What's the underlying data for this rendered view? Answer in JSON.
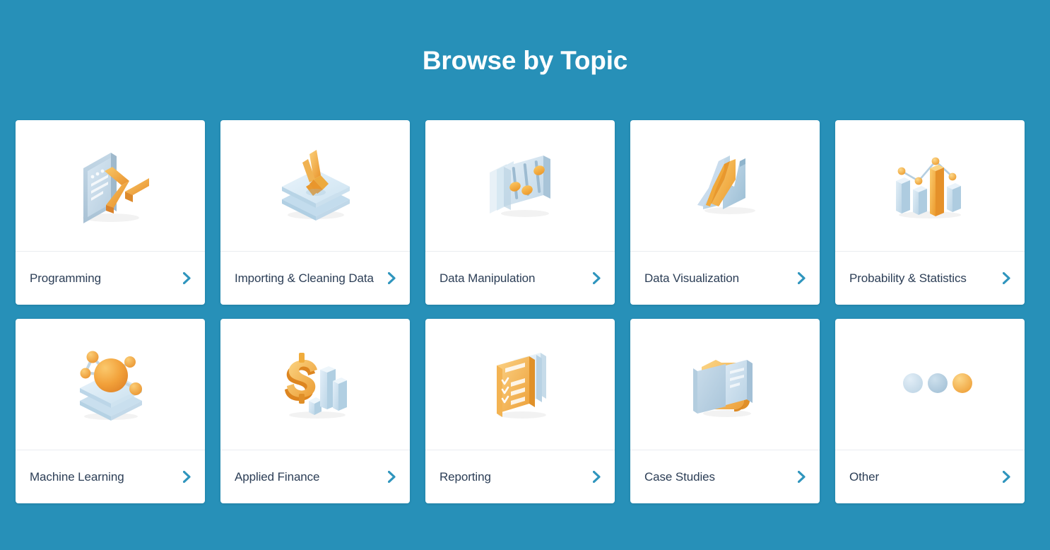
{
  "page": {
    "title": "Browse by Topic",
    "background_color": "#2790b8",
    "card_background_color": "#ffffff",
    "label_color": "#2c3e56",
    "chevron_color": "#2f95bd",
    "accent_orange": "#f2a33c",
    "accent_blue_light": "#d6e6f2"
  },
  "topics": [
    {
      "label": "Programming",
      "icon": "terminal-prompt-icon",
      "chevron": "chevron-right-icon"
    },
    {
      "label": "Importing & Cleaning Data",
      "icon": "down-arrow-layers-icon",
      "chevron": "chevron-right-icon"
    },
    {
      "label": "Data Manipulation",
      "icon": "sliders-icon",
      "chevron": "chevron-right-icon"
    },
    {
      "label": "Data Visualization",
      "icon": "area-chart-icon",
      "chevron": "chevron-right-icon"
    },
    {
      "label": "Probability & Statistics",
      "icon": "bar-line-chart-icon",
      "chevron": "chevron-right-icon"
    },
    {
      "label": "Machine Learning",
      "icon": "neural-network-icon",
      "chevron": "chevron-right-icon"
    },
    {
      "label": "Applied Finance",
      "icon": "dollar-bars-icon",
      "chevron": "chevron-right-icon"
    },
    {
      "label": "Reporting",
      "icon": "checklist-document-icon",
      "chevron": "chevron-right-icon"
    },
    {
      "label": "Case Studies",
      "icon": "folder-document-icon",
      "chevron": "chevron-right-icon"
    },
    {
      "label": "Other",
      "icon": "ellipsis-dots-icon",
      "chevron": "chevron-right-icon"
    }
  ]
}
